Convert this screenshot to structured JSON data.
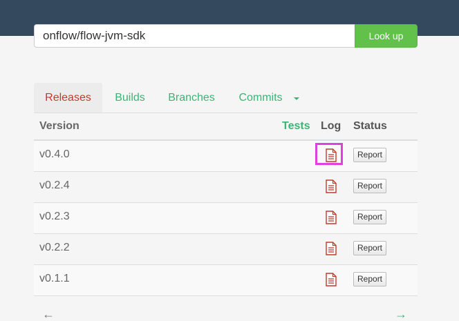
{
  "search": {
    "value": "onflow/flow-jvm-sdk",
    "button_label": "Look up"
  },
  "tabs": [
    {
      "label": "Releases",
      "active": true
    },
    {
      "label": "Builds",
      "active": false
    },
    {
      "label": "Branches",
      "active": false
    },
    {
      "label": "Commits",
      "active": false,
      "has_dropdown": true
    }
  ],
  "table": {
    "headers": {
      "version": "Version",
      "tests": "Tests",
      "log": "Log",
      "status": "Status"
    },
    "rows": [
      {
        "version": "v0.4.0",
        "status_button": "Report",
        "log_icon": "document-icon",
        "highlighted": true
      },
      {
        "version": "v0.2.4",
        "status_button": "Report",
        "log_icon": "document-icon"
      },
      {
        "version": "v0.2.3",
        "status_button": "Report",
        "log_icon": "document-icon"
      },
      {
        "version": "v0.2.2",
        "status_button": "Report",
        "log_icon": "document-icon"
      },
      {
        "version": "v0.1.1",
        "status_button": "Report",
        "log_icon": "document-icon"
      }
    ]
  },
  "pagination": {
    "prev": "←",
    "next": "→"
  },
  "colors": {
    "topbar": "#34495e",
    "accent_green": "#3ab574",
    "button_green": "#62c14a",
    "active_tab_red": "#c0392b",
    "highlight_magenta": "#e040e0"
  }
}
